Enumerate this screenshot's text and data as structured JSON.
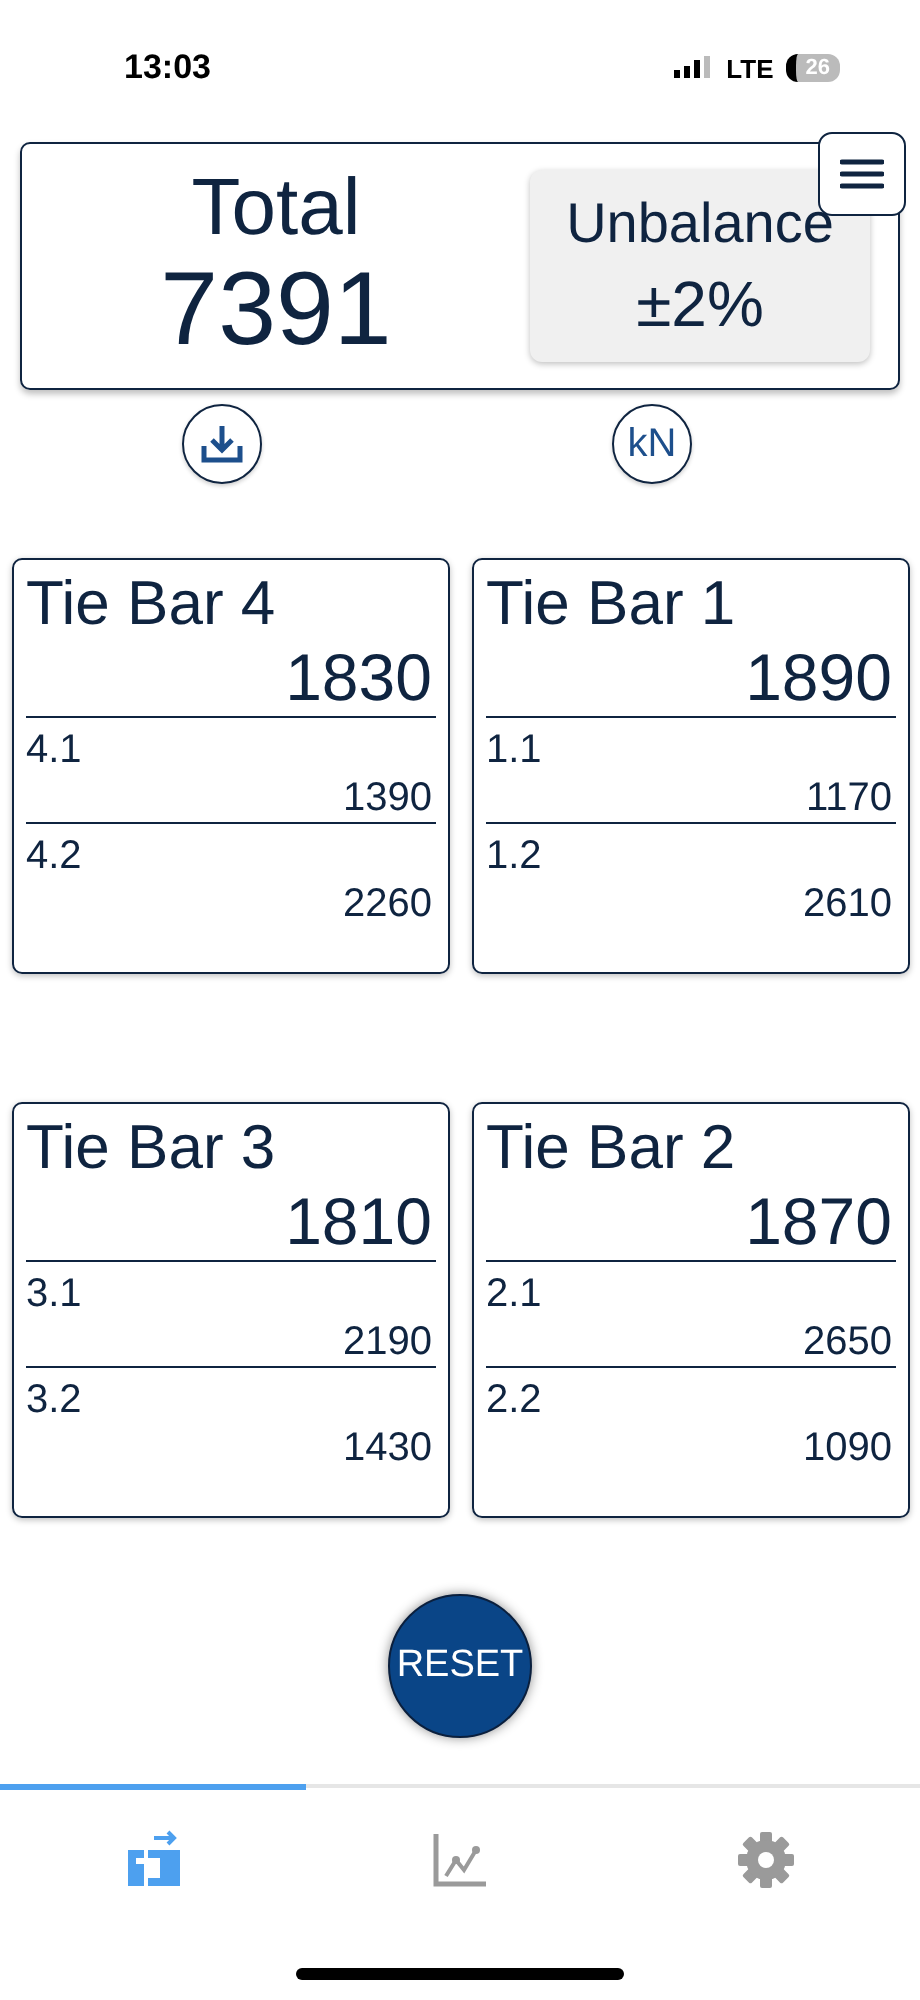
{
  "status_bar": {
    "time": "13:03",
    "network": "LTE",
    "battery": "26"
  },
  "summary": {
    "total_label": "Total",
    "total_value": "7391",
    "unbalance_label": "Unbalance",
    "unbalance_value": "±2%"
  },
  "unit_button": "kN",
  "tie_bars": [
    {
      "title": "Tie Bar 4",
      "value": "1830",
      "sensors": [
        {
          "label": "4.1",
          "value": "1390"
        },
        {
          "label": "4.2",
          "value": "2260"
        }
      ]
    },
    {
      "title": "Tie Bar 1",
      "value": "1890",
      "sensors": [
        {
          "label": "1.1",
          "value": "1170"
        },
        {
          "label": "1.2",
          "value": "2610"
        }
      ]
    },
    {
      "title": "Tie Bar 3",
      "value": "1810",
      "sensors": [
        {
          "label": "3.1",
          "value": "2190"
        },
        {
          "label": "3.2",
          "value": "1430"
        }
      ]
    },
    {
      "title": "Tie Bar 2",
      "value": "1870",
      "sensors": [
        {
          "label": "2.1",
          "value": "2650"
        },
        {
          "label": "2.2",
          "value": "1090"
        }
      ]
    }
  ],
  "reset_button": "RESET",
  "tabs": [
    {
      "kind": "press",
      "selected": true
    },
    {
      "kind": "chart",
      "selected": false
    },
    {
      "kind": "settings",
      "selected": false
    }
  ]
}
